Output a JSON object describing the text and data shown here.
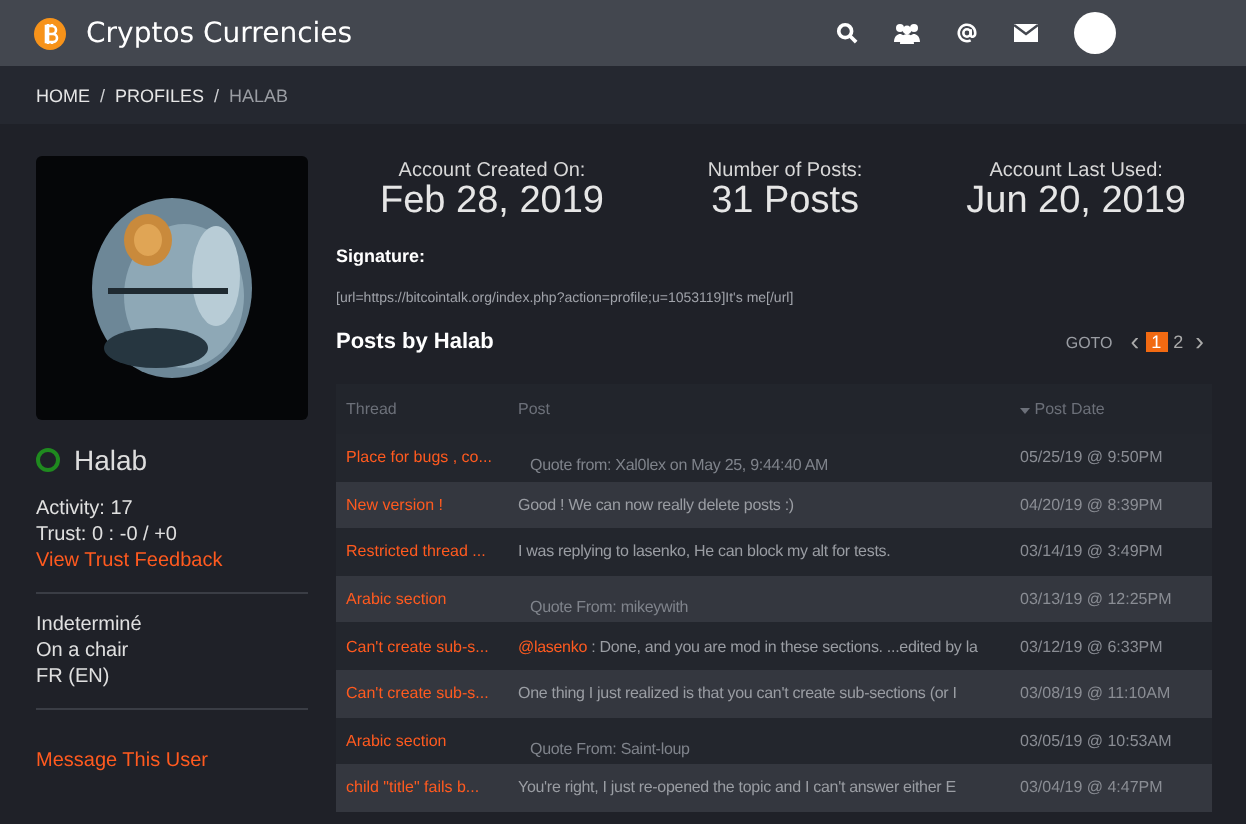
{
  "header": {
    "title": "Cryptos Currencies"
  },
  "breadcrumb": [
    {
      "label": "HOME",
      "selected": false
    },
    {
      "label": "PROFILES",
      "selected": false
    },
    {
      "label": "HALAB",
      "selected": true
    }
  ],
  "breadcrumb_separator": "/",
  "profile": {
    "name": "Halab",
    "online": true,
    "activity": "Activity: 17",
    "trust": "Trust: 0 : -0 / +0",
    "trust_link": "View Trust Feedback",
    "details": [
      "Indeterminé",
      "On a chair",
      "FR (EN)"
    ],
    "message_link": "Message This User"
  },
  "stats": [
    {
      "label": "Account Created On:",
      "value": "Feb 28, 2019"
    },
    {
      "label": "Number of Posts:",
      "value": "31 Posts"
    },
    {
      "label": "Account Last Used:",
      "value": "Jun 20, 2019"
    }
  ],
  "signature": {
    "label": "Signature:",
    "text": "[url=https://bitcointalk.org/index.php?action=profile;u=1053119]It's me[/url]"
  },
  "posts_title": "Posts by Halab",
  "pagination": {
    "goto": "GOTO",
    "prev": "‹",
    "next": "›",
    "pages": [
      {
        "label": "1",
        "selected": true
      },
      {
        "label": "2",
        "selected": false
      }
    ]
  },
  "table": {
    "columns": [
      "Thread",
      "Post",
      "Post Date"
    ],
    "rows": [
      {
        "thread": "Place for bugs , co...",
        "kind": "quote",
        "post": "Quote from: Xal0lex on May 25, 9:44:40 AM",
        "date": "05/25/19 @ 9:50PM"
      },
      {
        "thread": "New version !",
        "kind": "text",
        "post": "Good ! We can now really delete posts :)",
        "date": "04/20/19 @ 8:39PM"
      },
      {
        "thread": "Restricted thread ...",
        "kind": "text",
        "post": "I was replying to lasenko, He can block my alt for tests.",
        "date": "03/14/19 @ 3:49PM"
      },
      {
        "thread": "Arabic section",
        "kind": "quote",
        "post": "Quote From: mikeywith",
        "date": "03/13/19 @ 12:25PM"
      },
      {
        "thread": "Can't create sub-s...",
        "kind": "mention",
        "mention": "@lasenko",
        "post": " : Done, and you are mod in these sections. ...edited by la",
        "date": "03/12/19 @ 6:33PM"
      },
      {
        "thread": "Can't create sub-s...",
        "kind": "text",
        "post": "One thing I just realized is that you can't create sub-sections (or I",
        "date": "03/08/19 @ 11:10AM"
      },
      {
        "thread": "Arabic section",
        "kind": "quote",
        "post": "Quote From: Saint-loup",
        "date": "03/05/19 @ 10:53AM"
      },
      {
        "thread": "child \"title\" fails b...",
        "kind": "text",
        "post": "You're right, I just re-opened the topic and I can't answer either E",
        "date": "03/04/19 @ 4:47PM"
      }
    ]
  }
}
